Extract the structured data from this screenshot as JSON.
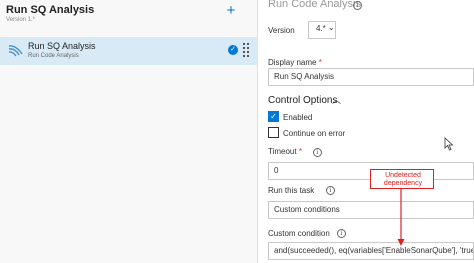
{
  "pipeline": {
    "title": "Run SQ Analysis",
    "version": "Version 1.*",
    "add_icon": "plus-icon"
  },
  "task": {
    "name": "Run SQ Analysis",
    "subtitle": "Run Code Analysis",
    "icon": "sonarqube-wave-icon",
    "status_icon": "checkmark-circle-icon",
    "drag_icon": "grip-icon"
  },
  "panel": {
    "title": "Run Code Analysis",
    "version_label": "Version",
    "version_value": "4.*",
    "display_name_label": "Display name",
    "required_mark": "*",
    "display_name_value": "Run SQ Analysis",
    "control_options_label": "Control Options",
    "enabled_label": "Enabled",
    "continue_on_error_label": "Continue on error",
    "timeout_label": "Timeout",
    "timeout_value": "0",
    "run_this_task_label": "Run this task",
    "run_this_task_value": "Custom conditions",
    "custom_condition_label": "Custom condition",
    "custom_condition_value": "and(succeeded(), eq(variables['EnableSonarQube'], 'true'))"
  },
  "annotation": {
    "line1": "Undetected",
    "line2": "dependency",
    "color": "#e02020"
  },
  "colors": {
    "accent": "#0078d4",
    "selected_row": "#d9eaf7"
  }
}
